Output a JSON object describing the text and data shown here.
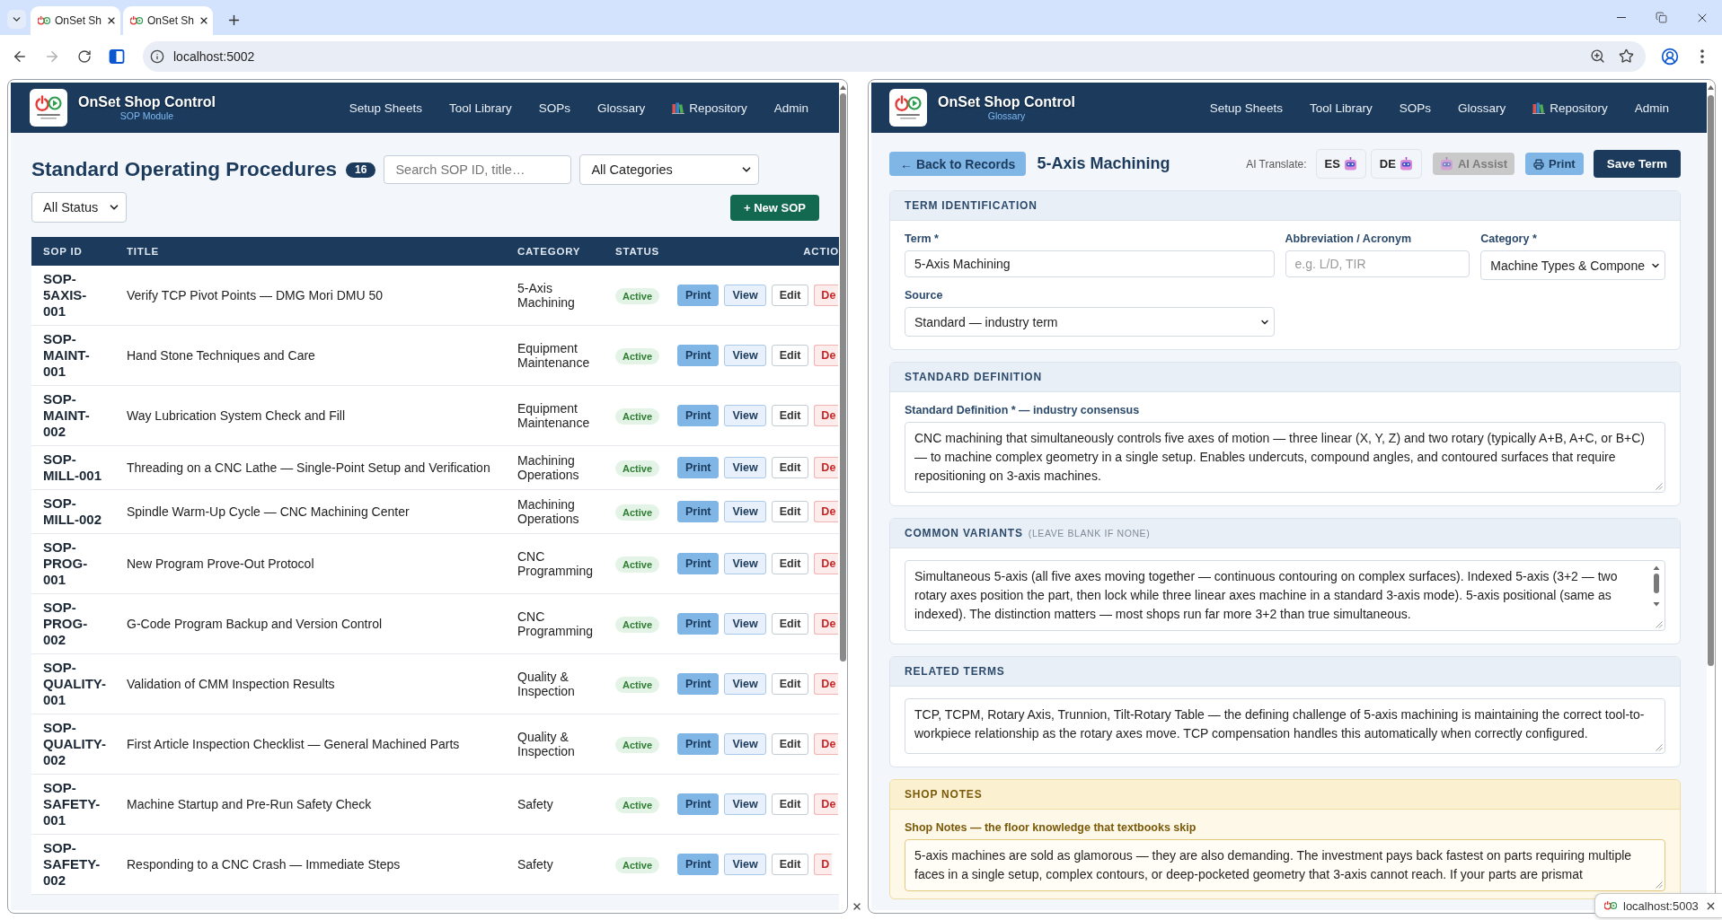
{
  "browser": {
    "tabs": [
      {
        "title": "OnSet Sh",
        "selected": true
      },
      {
        "title": "OnSet Sh",
        "selected": true
      }
    ],
    "address": "localhost:5002"
  },
  "left_pane": {
    "header": {
      "title": "OnSet Shop Control",
      "subtitle": "SOP Module",
      "nav": [
        {
          "label": "Setup Sheets",
          "kind": "plain"
        },
        {
          "label": "Tool Library",
          "kind": "plain"
        },
        {
          "label": "SOPs",
          "kind": "plain"
        },
        {
          "label": "Glossary",
          "kind": "plain"
        },
        {
          "label": "Repository",
          "kind": "icon"
        },
        {
          "label": "Admin",
          "kind": "plain"
        }
      ]
    },
    "title": "Standard Operating Procedures",
    "count": "16",
    "search": {
      "placeholder": "Search SOP ID, title…"
    },
    "category_filter": "All Categories",
    "status_filter": "All Status",
    "new_button": "+ New SOP",
    "table": {
      "columns": [
        "SOP ID",
        "TITLE",
        "CATEGORY",
        "STATUS",
        "ACTIO"
      ],
      "rows": [
        {
          "id": "SOP-5AXIS-001",
          "title": "Verify TCP Pivot Points — DMG Mori DMU 50",
          "category": "5-Axis Machining",
          "status": "Active",
          "actions": [
            {
              "label": "Print",
              "kind": "print"
            },
            {
              "label": "View",
              "kind": "view"
            },
            {
              "label": "Edit",
              "kind": "edit"
            },
            {
              "label": "De",
              "kind": "delete"
            }
          ]
        },
        {
          "id": "SOP-MAINT-001",
          "title": "Hand Stone Techniques and Care",
          "category": "Equipment Maintenance",
          "status": "Active",
          "actions": [
            {
              "label": "Print",
              "kind": "print"
            },
            {
              "label": "View",
              "kind": "view"
            },
            {
              "label": "Edit",
              "kind": "edit"
            },
            {
              "label": "De",
              "kind": "delete"
            }
          ]
        },
        {
          "id": "SOP-MAINT-002",
          "title": "Way Lubrication System Check and Fill",
          "category": "Equipment Maintenance",
          "status": "Active",
          "actions": [
            {
              "label": "Print",
              "kind": "print"
            },
            {
              "label": "View",
              "kind": "view"
            },
            {
              "label": "Edit",
              "kind": "edit"
            },
            {
              "label": "De",
              "kind": "delete"
            }
          ]
        },
        {
          "id": "SOP-MILL-001",
          "title": "Threading on a CNC Lathe — Single-Point Setup and Verification",
          "category": "Machining Operations",
          "status": "Active",
          "actions": [
            {
              "label": "Print",
              "kind": "print"
            },
            {
              "label": "View",
              "kind": "view"
            },
            {
              "label": "Edit",
              "kind": "edit"
            },
            {
              "label": "De",
              "kind": "delete"
            }
          ]
        },
        {
          "id": "SOP-MILL-002",
          "title": "Spindle Warm-Up Cycle — CNC Machining Center",
          "category": "Machining Operations",
          "status": "Active",
          "actions": [
            {
              "label": "Print",
              "kind": "print"
            },
            {
              "label": "View",
              "kind": "view"
            },
            {
              "label": "Edit",
              "kind": "edit"
            },
            {
              "label": "De",
              "kind": "delete"
            }
          ]
        },
        {
          "id": "SOP-PROG-001",
          "title": "New Program Prove-Out Protocol",
          "category": "CNC Programming",
          "status": "Active",
          "actions": [
            {
              "label": "Print",
              "kind": "print"
            },
            {
              "label": "View",
              "kind": "view"
            },
            {
              "label": "Edit",
              "kind": "edit"
            },
            {
              "label": "De",
              "kind": "delete"
            }
          ]
        },
        {
          "id": "SOP-PROG-002",
          "title": "G-Code Program Backup and Version Control",
          "category": "CNC Programming",
          "status": "Active",
          "actions": [
            {
              "label": "Print",
              "kind": "print"
            },
            {
              "label": "View",
              "kind": "view"
            },
            {
              "label": "Edit",
              "kind": "edit"
            },
            {
              "label": "De",
              "kind": "delete"
            }
          ]
        },
        {
          "id": "SOP-QUALITY-001",
          "title": "Validation of CMM Inspection Results",
          "category": "Quality & Inspection",
          "status": "Active",
          "actions": [
            {
              "label": "Print",
              "kind": "print"
            },
            {
              "label": "View",
              "kind": "view"
            },
            {
              "label": "Edit",
              "kind": "edit"
            },
            {
              "label": "De",
              "kind": "delete"
            }
          ]
        },
        {
          "id": "SOP-QUALITY-002",
          "title": "First Article Inspection Checklist — General Machined Parts",
          "category": "Quality & Inspection",
          "status": "Active",
          "actions": [
            {
              "label": "Print",
              "kind": "print"
            },
            {
              "label": "View",
              "kind": "view"
            },
            {
              "label": "Edit",
              "kind": "edit"
            },
            {
              "label": "De",
              "kind": "delete"
            }
          ]
        },
        {
          "id": "SOP-SAFETY-001",
          "title": "Machine Startup and Pre-Run Safety Check",
          "category": "Safety",
          "status": "Active",
          "actions": [
            {
              "label": "Print",
              "kind": "print"
            },
            {
              "label": "View",
              "kind": "view"
            },
            {
              "label": "Edit",
              "kind": "edit"
            },
            {
              "label": "De",
              "kind": "delete"
            }
          ]
        },
        {
          "id": "SOP-SAFETY-002",
          "title": "Responding to a CNC Crash — Immediate Steps",
          "category": "Safety",
          "status": "Active",
          "actions": [
            {
              "label": "Print",
              "kind": "print"
            },
            {
              "label": "View",
              "kind": "view"
            },
            {
              "label": "Edit",
              "kind": "edit"
            },
            {
              "label": "D",
              "kind": "delete"
            }
          ]
        }
      ]
    }
  },
  "right_pane": {
    "header": {
      "title": "OnSet Shop Control",
      "subtitle": "Glossary",
      "nav": [
        {
          "label": "Setup Sheets",
          "kind": "plain"
        },
        {
          "label": "Tool Library",
          "kind": "plain"
        },
        {
          "label": "SOPs",
          "kind": "plain"
        },
        {
          "label": "Glossary",
          "kind": "plain"
        },
        {
          "label": "Repository",
          "kind": "icon"
        },
        {
          "label": "Admin",
          "kind": "plain"
        }
      ]
    },
    "back_button": "← Back to Records",
    "record_title": "5-Axis Machining",
    "translate_label": "AI Translate:",
    "translate_buttons": [
      "ES",
      "DE"
    ],
    "ai_assist": {
      "label": "AI Assist",
      "disabled": true
    },
    "print_button": "Print",
    "save_button": "Save Term",
    "sections": [
      {
        "kind": "fields",
        "title": "TERM IDENTIFICATION",
        "fields": [
          {
            "label": "Term *",
            "kind": "input",
            "value": "5-Axis Machining"
          },
          {
            "label": "Abbreviation / Acronym",
            "kind": "input",
            "placeholder": "e.g. L/D, TIR"
          },
          {
            "label": "Category *",
            "kind": "select",
            "value": "Machine Types & Compone"
          },
          {
            "label": "Source",
            "kind": "select",
            "value": "Standard — industry term"
          }
        ]
      },
      {
        "kind": "text",
        "title": "STANDARD DEFINITION",
        "label": "Standard Definition * — industry consensus",
        "value": "CNC machining that simultaneously controls five axes of motion — three linear (X, Y, Z) and two rotary (typically A+B, A+C, or B+C) — to machine complex geometry in a single setup. Enables undercuts, compound angles, and contoured surfaces that require repositioning on 3-axis machines."
      },
      {
        "kind": "text",
        "title": "COMMON VARIANTS",
        "note": "(LEAVE BLANK IF NONE)",
        "scrollable": true,
        "value": "Simultaneous 5-axis (all five axes moving together — continuous contouring on complex surfaces). Indexed 5-axis (3+2 — two rotary axes position the part, then lock while three linear axes machine in a standard 3-axis mode). 5-axis positional (same as indexed). The distinction matters — most shops run far more 3+2 than true simultaneous."
      },
      {
        "kind": "text",
        "title": "RELATED TERMS",
        "value": "TCP, TCPM, Rotary Axis, Trunnion, Tilt-Rotary Table — the defining challenge of 5-axis machining is maintaining the correct tool-to-workpiece relationship as the rotary axes move. TCP compensation handles this automatically when correctly configured."
      },
      {
        "kind": "notes",
        "title": "SHOP NOTES",
        "label": "Shop Notes — the floor knowledge that textbooks skip",
        "value": "5-axis machines are sold as glamorous — they are also demanding. The investment pays back fastest on parts requiring multiple faces in a single setup, complex contours, or deep-pocketed geometry that 3-axis cannot reach. If your parts are prismat"
      }
    ]
  },
  "status_popup": {
    "url": "localhost:5003"
  }
}
